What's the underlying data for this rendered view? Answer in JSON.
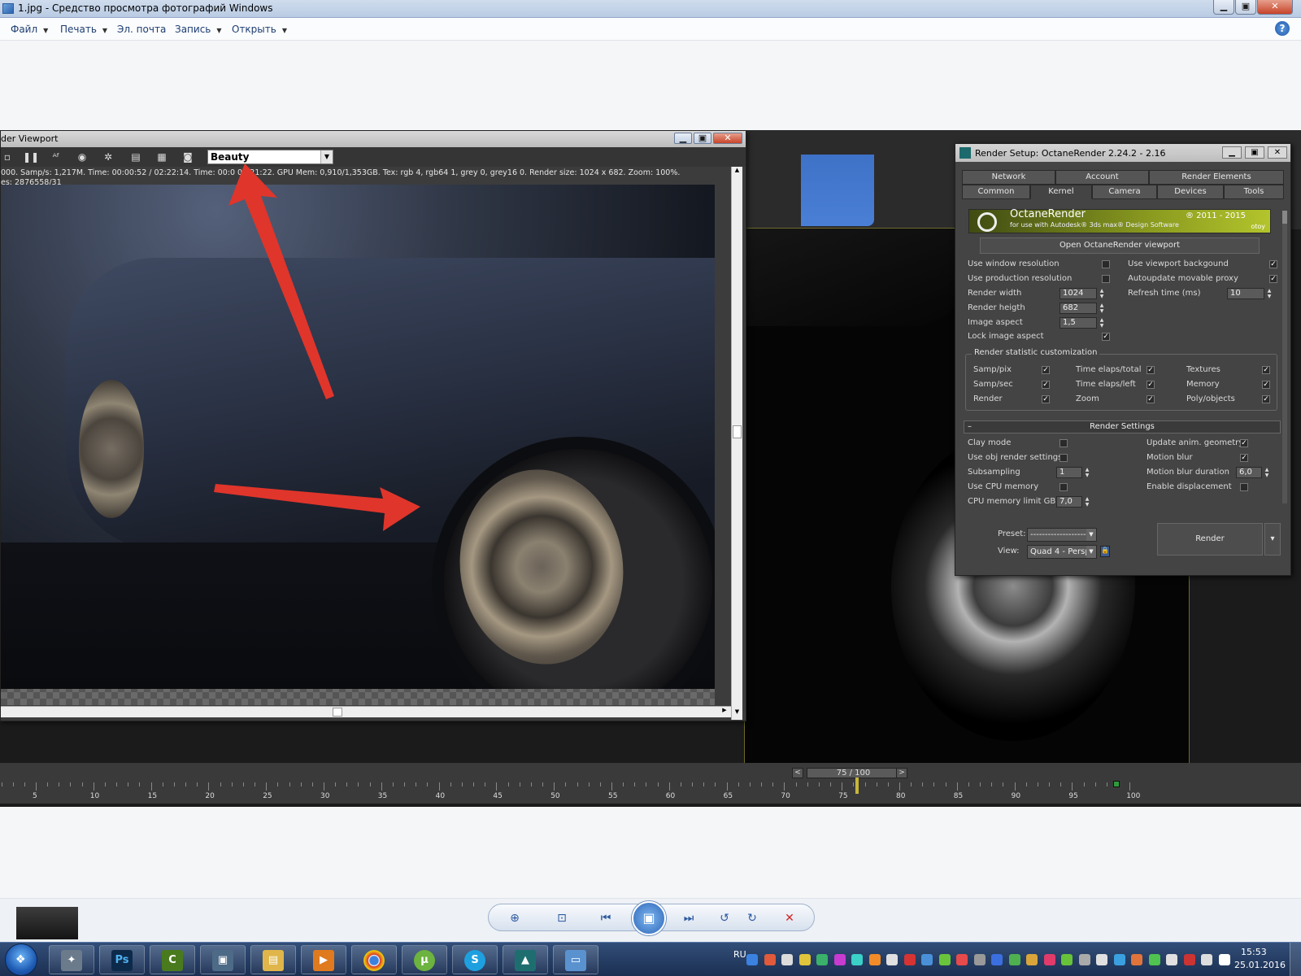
{
  "window": {
    "title": "1.jpg - Средство просмотра фотографий Windows",
    "minimize": "▁",
    "maximize": "▣",
    "close": "✕"
  },
  "menu": {
    "items": [
      {
        "label": "Файл",
        "has_arrow": true
      },
      {
        "label": "Печать",
        "has_arrow": true
      },
      {
        "label": "Эл. почта",
        "has_arrow": false
      },
      {
        "label": "Запись",
        "has_arrow": true
      },
      {
        "label": "Открыть",
        "has_arrow": true
      }
    ],
    "help": "?"
  },
  "render_viewport": {
    "title": "der Viewport",
    "pass_select": "Beauty",
    "status_line": "000.   Samp/s: 1,217M.   Time: 00:00:52 / 02:22:14.   Time: 00:0      02:21:22.   GPU Mem: 0,910/1,353GB.   Tex: rgb 4, rgb64 1, grey 0, grey16 0.   Render size: 1024 x 682.   Zoom: 100%.",
    "status_line2": "es: 2876558/31"
  },
  "render_setup": {
    "title": "Render Setup: OctaneRender 2.24.2 - 2.16",
    "tabs_row1": [
      "Network",
      "Account",
      "Render Elements"
    ],
    "tabs_row2": [
      "Common",
      "Kernel",
      "Camera",
      "Devices",
      "Tools"
    ],
    "active_tab": "Kernel",
    "banner": {
      "name": "OctaneRender",
      "subtitle": "for use with Autodesk® 3ds max® Design Software",
      "years": "® 2011 - 2015",
      "brand": "otoy"
    },
    "open_viewport_button": "Open OctaneRender viewport",
    "left_options": [
      {
        "label": "Use window resolution",
        "checked": false
      },
      {
        "label": "Use production resolution",
        "checked": false
      }
    ],
    "right_options": [
      {
        "label": "Use viewport backgound",
        "checked": true
      },
      {
        "label": "Autoupdate movable proxy",
        "checked": true
      }
    ],
    "render_width_label": "Render width",
    "render_width": "1024",
    "render_height_label": "Render heigth",
    "render_height": "682",
    "image_aspect_label": "Image aspect",
    "image_aspect": "1,5",
    "lock_aspect_label": "Lock image aspect",
    "lock_aspect": true,
    "refresh_label": "Refresh time (ms)",
    "refresh_value": "10",
    "stats_group_title": "Render statistic customization",
    "stats": [
      {
        "label": "Samp/pix",
        "checked": true
      },
      {
        "label": "Time elaps/total",
        "checked": true
      },
      {
        "label": "Textures",
        "checked": true
      },
      {
        "label": "Samp/sec",
        "checked": true
      },
      {
        "label": "Time elaps/left",
        "checked": true
      },
      {
        "label": "Memory",
        "checked": true
      },
      {
        "label": "Render",
        "checked": true
      },
      {
        "label": "Zoom",
        "checked": true
      },
      {
        "label": "Poly/objects",
        "checked": true
      }
    ],
    "render_settings_title": "Render Settings",
    "render_settings_minus": "–",
    "rs_left": [
      {
        "label": "Clay mode",
        "checked": false
      },
      {
        "label": "Use obj render settings",
        "checked": false
      }
    ],
    "subsampling_label": "Subsampling",
    "subsampling": "1",
    "use_cpu_mem_label": "Use CPU memory",
    "use_cpu_mem": false,
    "cpu_limit_label": "CPU memory limit GB",
    "cpu_limit": "7,0",
    "rs_right": [
      {
        "label": "Update anim. geometry",
        "checked": true
      },
      {
        "label": "Motion blur",
        "checked": true
      }
    ],
    "motion_blur_duration_label": "Motion blur duration",
    "motion_blur_duration": "6,0",
    "enable_displacement_label": "Enable displacement",
    "enable_displacement": false,
    "preset_label": "Preset:",
    "preset_value": "--------------------",
    "view_label": "View:",
    "view_value": "Quad 4 - Perspe",
    "render_button": "Render"
  },
  "timeline": {
    "frame": "75 / 100",
    "prev": "<",
    "next": ">",
    "ticks": [
      "5",
      "10",
      "15",
      "20",
      "25",
      "30",
      "35",
      "40",
      "45",
      "50",
      "55",
      "60",
      "65",
      "70",
      "75",
      "80",
      "85",
      "90",
      "95",
      "100"
    ]
  },
  "viewer_controls": {
    "zoom": "⊕",
    "fit": "⊡",
    "prev": "⏮",
    "slideshow": "▣",
    "next": "⏭",
    "rotate_ccw": "↺",
    "rotate_cw": "↻",
    "delete": "✕"
  },
  "taskbar": {
    "apps": [
      "",
      "Ps",
      "",
      "",
      "",
      "",
      "",
      "",
      "",
      "",
      ""
    ],
    "lang": "RU",
    "time": "15:53",
    "date": "25.01.2016"
  },
  "colors": {
    "arrow": "#e0352b",
    "viewport_border": "#6d6a2b"
  }
}
